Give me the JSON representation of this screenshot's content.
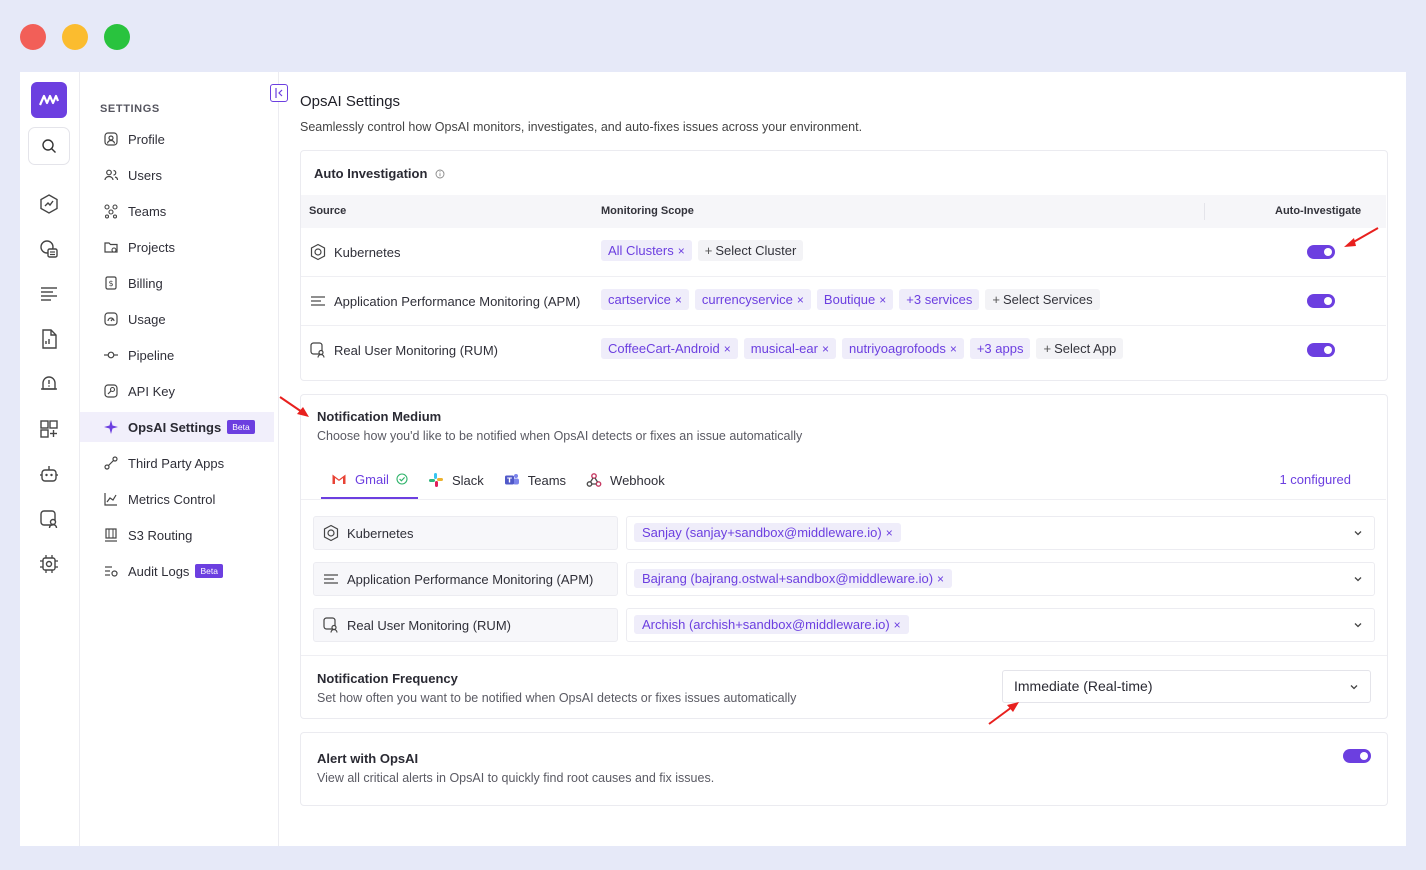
{
  "colors": {
    "accent": "#6c3fe0",
    "arrow": "#e8201e"
  },
  "window_controls": [
    "close",
    "minimize",
    "maximize"
  ],
  "rail": {
    "icons": [
      "logo-icon",
      "search-icon",
      "dashboard-icon",
      "infrastructure-icon",
      "logs-icon",
      "reports-icon",
      "alerts-icon",
      "apps-icon",
      "opsai-bot-icon",
      "rum-icon",
      "settings-icon"
    ]
  },
  "settings_nav": {
    "heading": "SETTINGS",
    "items": [
      {
        "label": "Profile",
        "icon": "profile-icon"
      },
      {
        "label": "Users",
        "icon": "users-icon"
      },
      {
        "label": "Teams",
        "icon": "teams-icon"
      },
      {
        "label": "Projects",
        "icon": "projects-icon"
      },
      {
        "label": "Billing",
        "icon": "billing-icon"
      },
      {
        "label": "Usage",
        "icon": "usage-icon"
      },
      {
        "label": "Pipeline",
        "icon": "pipeline-icon"
      },
      {
        "label": "API Key",
        "icon": "api-key-icon"
      },
      {
        "label": "OpsAI Settings",
        "icon": "opsai-icon",
        "badge": "Beta",
        "active": true
      },
      {
        "label": "Third Party Apps",
        "icon": "third-party-icon"
      },
      {
        "label": "Metrics Control",
        "icon": "metrics-icon"
      },
      {
        "label": "S3 Routing",
        "icon": "s3-icon"
      },
      {
        "label": "Audit Logs",
        "icon": "audit-icon",
        "badge": "Beta"
      }
    ]
  },
  "page": {
    "title": "OpsAI Settings",
    "subtitle": "Seamlessly control how OpsAI monitors, investigates, and auto-fixes issues across your environment."
  },
  "auto_investigation": {
    "title": "Auto Investigation",
    "columns": [
      "Source",
      "Monitoring Scope",
      "Auto-Investigate"
    ],
    "rows": [
      {
        "source": "Kubernetes",
        "scope": [
          "All Clusters"
        ],
        "add_label": "Select Cluster",
        "enabled": true
      },
      {
        "source": "Application Performance Monitoring (APM)",
        "scope": [
          "cartservice",
          "currencyservice",
          "Boutique",
          "+3 services"
        ],
        "add_label": "Select Services",
        "enabled": true
      },
      {
        "source": "Real User Monitoring (RUM)",
        "scope": [
          "CoffeeCart-Android",
          "musical-ear",
          "nutriyoagrofoods",
          "+3 apps"
        ],
        "add_label": "Select App",
        "enabled": true
      }
    ]
  },
  "notification_medium": {
    "title": "Notification Medium",
    "subtitle": "Choose how you'd like to be notified when OpsAI detects or fixes an issue automatically",
    "tabs": [
      "Gmail",
      "Slack",
      "Teams",
      "Webhook"
    ],
    "active_tab": "Gmail",
    "configured": "1 configured",
    "rows": [
      {
        "source": "Kubernetes",
        "recipient": "Sanjay (sanjay+sandbox@middleware.io)"
      },
      {
        "source": "Application Performance Monitoring (APM)",
        "recipient": "Bajrang (bajrang.ostwal+sandbox@middleware.io)"
      },
      {
        "source": "Real User Monitoring (RUM)",
        "recipient": "Archish (archish+sandbox@middleware.io)"
      }
    ]
  },
  "notification_frequency": {
    "title": "Notification Frequency",
    "subtitle": "Set how often you want to be notified when OpsAI detects or fixes issues automatically",
    "value": "Immediate (Real-time)"
  },
  "alert_opsai": {
    "title": "Alert with OpsAI",
    "subtitle": "View all critical alerts in OpsAI to quickly find root causes and fix issues.",
    "enabled": true
  }
}
